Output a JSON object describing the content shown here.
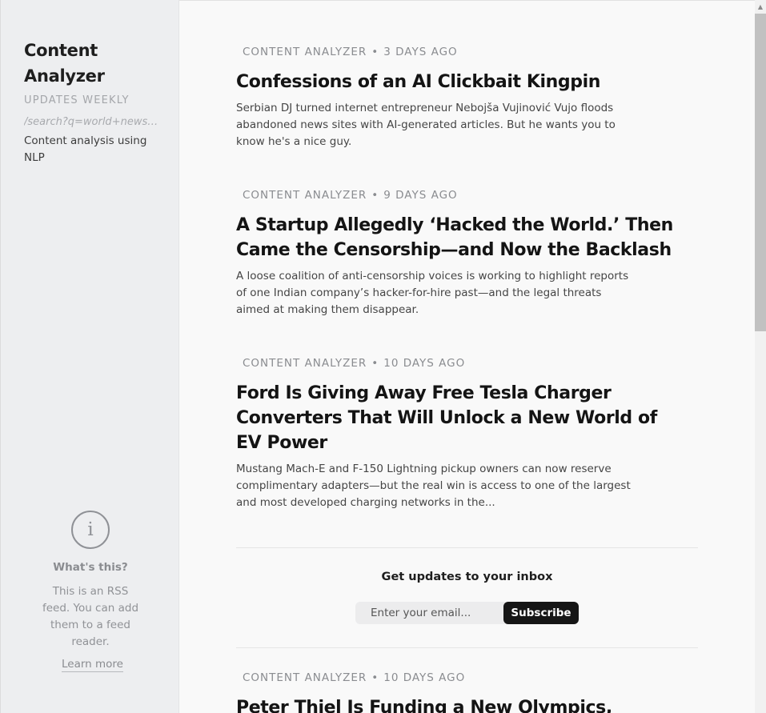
{
  "sidebar": {
    "feed_title": "Content Analyzer",
    "frequency": "UPDATES WEEKLY",
    "feed_url": "/search?q=world+news&…",
    "description": "Content analysis using NLP",
    "info": {
      "icon": "info-icon",
      "glyph": "i",
      "heading": "What's this?",
      "text": "This is an RSS feed. You can add them to a feed reader.",
      "link": "Learn more"
    }
  },
  "articles": [
    {
      "source": "CONTENT ANALYZER",
      "separator": "•",
      "age": "3 DAYS AGO",
      "title": "Confessions of an AI Clickbait Kingpin",
      "summary": "Serbian DJ turned internet entrepreneur Nebojša Vujinović Vujo floods abandoned news sites with AI-generated articles. But he wants you to know he's a nice guy."
    },
    {
      "source": "CONTENT ANALYZER",
      "separator": "•",
      "age": "9 DAYS AGO",
      "title": "A Startup Allegedly ‘Hacked the World.’ Then Came the Censorship—and Now the Backlash",
      "summary": "A loose coalition of anti-censorship voices is working to highlight reports of one Indian company’s hacker-for-hire past—and the legal threats aimed at making them disappear."
    },
    {
      "source": "CONTENT ANALYZER",
      "separator": "•",
      "age": "10 DAYS AGO",
      "title": "Ford Is Giving Away Free Tesla Charger Converters That Will Unlock a New World of EV Power",
      "summary": "Mustang Mach-E and F-150 Lightning pickup owners can now reserve complimentary adapters—but the real win is access to one of the largest and most developed charging networks in the..."
    },
    {
      "source": "CONTENT ANALYZER",
      "separator": "•",
      "age": "10 DAYS AGO",
      "title": "Peter Thiel Is Funding a New Olympics, Steroids Not Banned",
      "summary": ""
    }
  ],
  "subscribe": {
    "heading": "Get updates to your inbox",
    "email_placeholder": "Enter your email...",
    "button_label": "Subscribe"
  },
  "scrollbar": {
    "up_arrow": "▲"
  }
}
